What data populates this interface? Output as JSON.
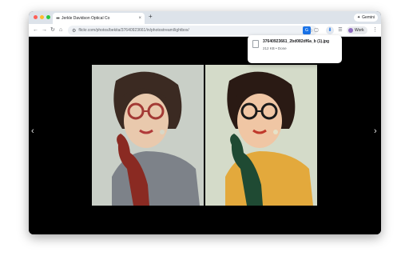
{
  "browser": {
    "tab": {
      "favicon": "flickr-icon",
      "title": "Jerkle Davidson Optical Co"
    },
    "gemini_label": "Gemini",
    "url": "flickr.com/photos/bekita/37640923661/in/photostream/lightbox/",
    "profile_label": "Work"
  },
  "download": {
    "filename": "37640923661_2bd082df6a_b (1).jpg",
    "status": "212 KB • Done"
  },
  "colors": {
    "red_glove": "#8a2a22",
    "green_glove": "#1f4a33",
    "gray_top": "#7d8289",
    "yellow_top": "#e3a93c",
    "left_bg": "#c9cfc7",
    "right_bg": "#d4dbc9"
  }
}
